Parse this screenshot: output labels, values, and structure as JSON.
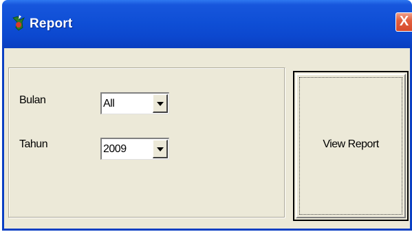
{
  "window": {
    "title": "Report",
    "close_symbol": "X",
    "icon": "report-app-icon"
  },
  "form": {
    "bulan": {
      "label": "Bulan",
      "value": "All"
    },
    "tahun": {
      "label": "Tahun",
      "value": "2009"
    }
  },
  "actions": {
    "view_report_label": "View Report"
  },
  "colors": {
    "titlebar": "#0c48cf",
    "frame": "#0a3fc4",
    "face": "#ece9d8",
    "close": "#d64a2c"
  }
}
